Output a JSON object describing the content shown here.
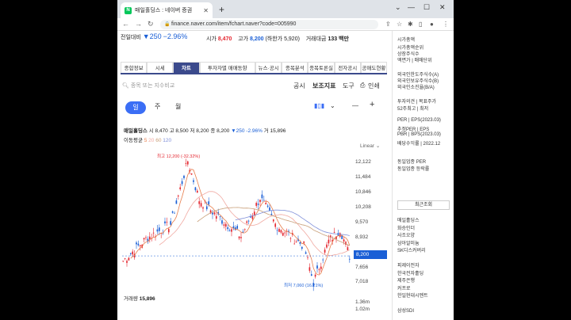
{
  "browser": {
    "tab_title": "매일홀딩스 : 네이버 증권",
    "url": "finance.naver.com/item/fchart.naver?code=005990"
  },
  "quote": {
    "prev_label": "전일대비",
    "prev": "▼250",
    "pct": "−2.96%",
    "open_label": "시가",
    "open": "8,470",
    "high_label": "고가",
    "high": "8,200",
    "high_sub": "(하한가 5,920)",
    "vol_label": "거래대금",
    "vol": "133 백만"
  },
  "tabs": [
    "종합정보",
    "시세",
    "차트",
    "투자자별 매매동향",
    "뉴스·공시",
    "종목분석",
    "종목토론실",
    "전자공시",
    "공매도현황"
  ],
  "search_placeholder": "종목 또는 지수비교",
  "tools": [
    "공시",
    "보조지표",
    "도구",
    "인쇄"
  ],
  "period": [
    "일",
    "주",
    "월"
  ],
  "info": {
    "name": "매일홀딩스",
    "o": "시 8,470",
    "h": "고 8,500",
    "l": "저 8,200",
    "c": "종 8,200",
    "chg": "▼250 -2.96%",
    "v": "거 15,896"
  },
  "ma": {
    "label": "이동평균",
    "p1": "5",
    "p2": "20",
    "p3": "60",
    "p4": "120"
  },
  "linear": "Linear",
  "yaxis": [
    "12,122",
    "11,484",
    "10,846",
    "10,208",
    "9,570",
    "8,932",
    "7,656",
    "7,018"
  ],
  "current": "8,200",
  "max_label": "최고 12,200 (-32.32%)",
  "min_label": "최저 7,060 (16.21%)",
  "volume": {
    "label": "거래량",
    "value": "15,896",
    "axis1": "1.36m",
    "axis2": "1.02m"
  },
  "side": [
    "시가총액",
    "시가총액순위",
    "상장주식수",
    "액면가 | 매매단위",
    "외국인한도주식수(A)",
    "외국인보유주식수(B)",
    "외국인소진율(B/A)",
    "투자의견 | 목표주가",
    "52주최고 | 최저",
    "PER | EPS(2023.03)",
    "추정PER | EPS",
    "PBR | BPS(2023.03)",
    "배당수익률 | 2022.12",
    "동일업종 PER",
    "동일업종 등락률"
  ],
  "recent_title": "최근조회",
  "recent": [
    "매일홀딩스",
    "화승인더",
    "사조오양",
    "삼아알미늄",
    "SK디스커버리",
    "",
    "피제이전자",
    "한국전자홀딩",
    "제주은행",
    "커프로",
    "한일현대시멘트",
    "",
    "삼성SDI"
  ],
  "colors": {
    "up": "#e4262f",
    "down": "#1a5fd6",
    "ma5": "#e77d4b",
    "ma20": "#f0a8a0",
    "ma60": "#c9a07a",
    "ma120": "#7f8fd9"
  }
}
